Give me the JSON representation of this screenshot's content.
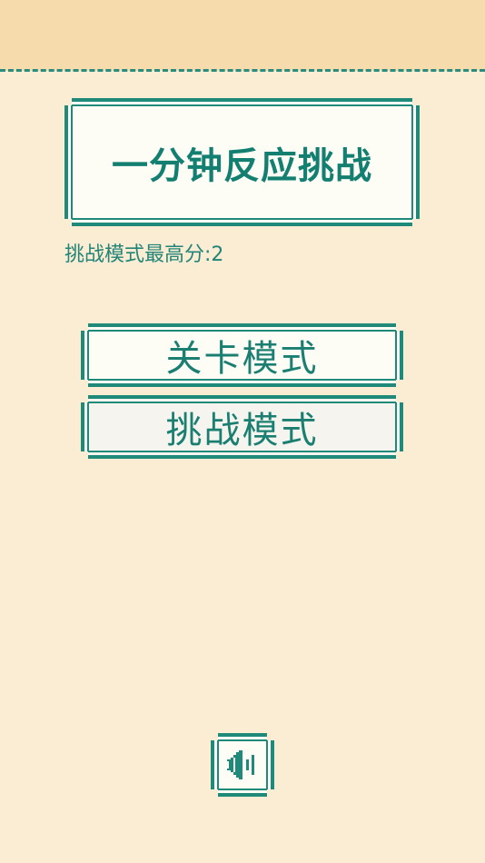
{
  "header": {
    "bg_color": "#f6dbac",
    "border_color": "#2a8c7e"
  },
  "title": {
    "text": "一分钟反应挑战"
  },
  "best_score": {
    "text": "挑战模式最高分:2"
  },
  "modes": {
    "level_label": "关卡模式",
    "challenge_label": "挑战模式"
  },
  "sound": {
    "icon": "speaker-icon"
  },
  "colors": {
    "background": "#fbecd4",
    "accent": "#1f8a7a",
    "panel": "#fdfcf5"
  }
}
